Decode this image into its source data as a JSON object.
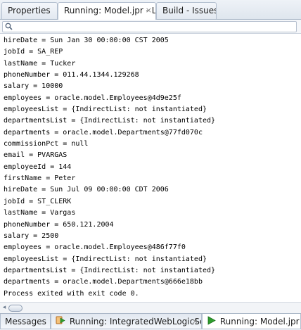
{
  "tabs": [
    {
      "label": "Properties"
    },
    {
      "label": "Running: Model.jpr - Log",
      "close": "×"
    },
    {
      "label": "Build - Issues"
    }
  ],
  "search": {
    "placeholder": "",
    "value": ""
  },
  "log_lines": [
    "hireDate = Sun Jan 30 00:00:00 CST 2005",
    "jobId = SA_REP",
    "lastName = Tucker",
    "phoneNumber = 011.44.1344.129268",
    "salary = 10000",
    "employees = oracle.model.Employees@4d9e25f",
    "employeesList = {IndirectList: not instantiated}",
    "departmentsList = {IndirectList: not instantiated}",
    "departments = oracle.model.Departments@77fd070c",
    "commissionPct = null",
    "email = PVARGAS",
    "employeeId = 144",
    "firstName = Peter",
    "hireDate = Sun Jul 09 00:00:00 CDT 2006",
    "jobId = ST_CLERK",
    "lastName = Vargas",
    "phoneNumber = 650.121.2004",
    "salary = 2500",
    "employees = oracle.model.Employees@486f77f0",
    "employeesList = {IndirectList: not instantiated}",
    "departmentsList = {IndirectList: not instantiated}",
    "departments = oracle.model.Departments@666e18bb",
    "Process exited with exit code 0."
  ],
  "bottom_tabs": [
    {
      "label": "Messages"
    },
    {
      "label": "Running: IntegratedWebLogicServer",
      "close": "×",
      "icon": "server-run-icon"
    },
    {
      "label": "Running: Model.jpr",
      "icon": "play-icon"
    }
  ],
  "colors": {
    "tab_border": "#b3bfcf",
    "play_green": "#2e9e2e",
    "server_orange": "#d9822b"
  }
}
